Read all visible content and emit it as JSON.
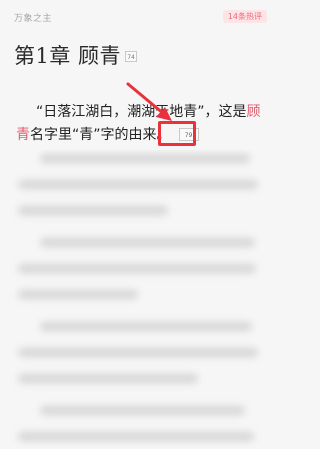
{
  "header": {
    "book_title": "万象之主",
    "comments_badge": "14条热评"
  },
  "chapter": {
    "title": "第1章 顾青",
    "comment_count": "74"
  },
  "content": {
    "line1": "“日落江湖白，潮湖天地青”，这是",
    "line1_red": "顾",
    "line2_red": "青",
    "line2_rest": "名字里“青”字的由来。",
    "paragraph_comment_count": "79"
  },
  "colors": {
    "accent_red": "#e8323c",
    "highlight_text": "#e05a6a",
    "badge_bg": "#fde4e7"
  }
}
